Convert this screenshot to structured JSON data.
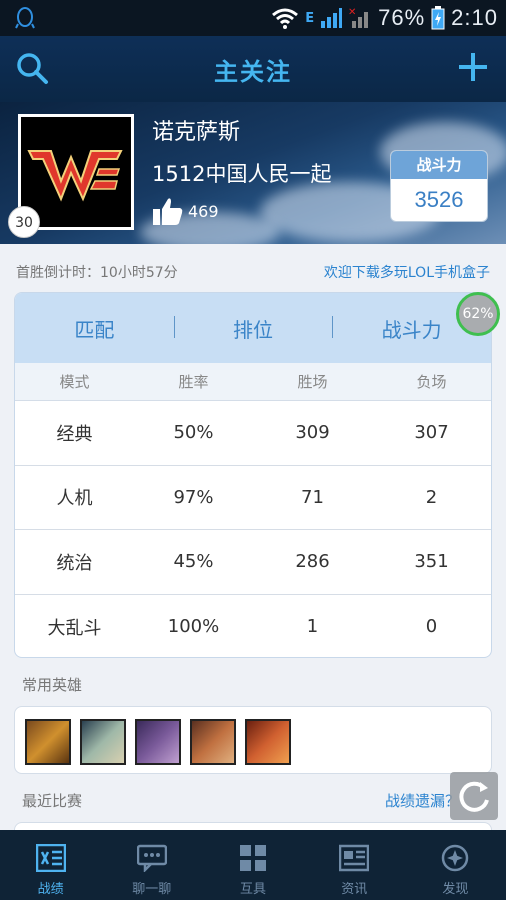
{
  "status_bar": {
    "network": "E",
    "battery_percent": "76%",
    "time": "2:10"
  },
  "header": {
    "title": "主关注"
  },
  "profile": {
    "name": "诺克萨斯",
    "guild": "1512中国人民一起",
    "likes": "469",
    "level": "30",
    "power_label": "战斗力",
    "power_value": "3526",
    "team_logo_text": "WE"
  },
  "info": {
    "countdown": "首胜倒计时：10小时57分",
    "download_link": "欢迎下载多玩LOL手机盒子"
  },
  "stats": {
    "tabs": [
      "匹配",
      "排位",
      "战斗力"
    ],
    "columns": [
      "模式",
      "胜率",
      "胜场",
      "负场"
    ],
    "rows": [
      [
        "经典",
        "50%",
        "309",
        "307"
      ],
      [
        "人机",
        "97%",
        "71",
        "2"
      ],
      [
        "统治",
        "45%",
        "286",
        "351"
      ],
      [
        "大乱斗",
        "100%",
        "1",
        "0"
      ]
    ],
    "progress_badge": "62%"
  },
  "heroes": {
    "title": "常用英雄",
    "count": 5
  },
  "recent": {
    "title": "最近比赛",
    "link": "战绩遗漏？"
  },
  "bottom_nav": [
    "战绩",
    "聊一聊",
    "互具",
    "资讯",
    "发现"
  ],
  "colors": {
    "accent": "#45b6f0",
    "header_bg": "#0e2f57",
    "link": "#2b83cf",
    "tab_bg": "#c8def4"
  }
}
